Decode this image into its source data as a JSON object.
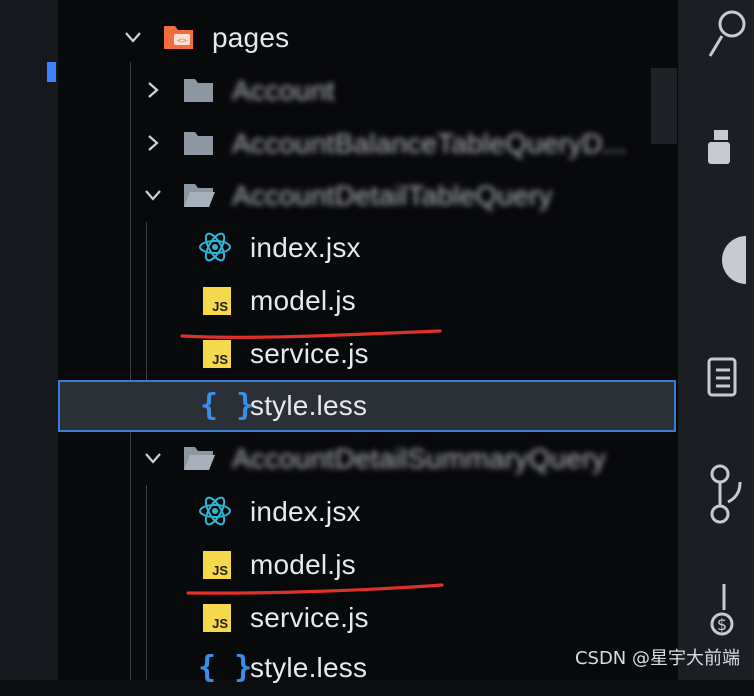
{
  "explorer": {
    "root": {
      "label": "pages",
      "expanded": true
    },
    "items": [
      {
        "label": "Account",
        "type": "folder",
        "expanded": false,
        "blurred": true
      },
      {
        "label": "AccountBalanceTableQueryD...",
        "type": "folder",
        "expanded": false,
        "blurred": true
      },
      {
        "label": "AccountDetailTableQuery",
        "type": "folder",
        "expanded": true,
        "blurred": true,
        "children": [
          {
            "label": "index.jsx",
            "icon": "react-icon"
          },
          {
            "label": "model.js",
            "icon": "js-icon",
            "underlined": true
          },
          {
            "label": "service.js",
            "icon": "js-icon"
          },
          {
            "label": "style.less",
            "icon": "braces-icon",
            "selected": true
          }
        ]
      },
      {
        "label": "AccountDetailSummaryQuery",
        "type": "folder",
        "expanded": true,
        "blurred": true,
        "children": [
          {
            "label": "index.jsx",
            "icon": "react-icon"
          },
          {
            "label": "model.js",
            "icon": "js-icon",
            "underlined": true
          },
          {
            "label": "service.js",
            "icon": "js-icon"
          },
          {
            "label": "style.less",
            "icon": "braces-icon"
          }
        ]
      }
    ]
  },
  "js_badge_text": "JS",
  "brace_glyph": "{ }",
  "colors": {
    "accent": "#3a7bd5",
    "js_yellow": "#f5d94b",
    "react_cyan": "#2fb6d6",
    "less_blue": "#3b8ee8",
    "folder_orange": "#f26d3d",
    "underline_red": "#e0302a"
  },
  "watermark": "CSDN @星宇大前端"
}
